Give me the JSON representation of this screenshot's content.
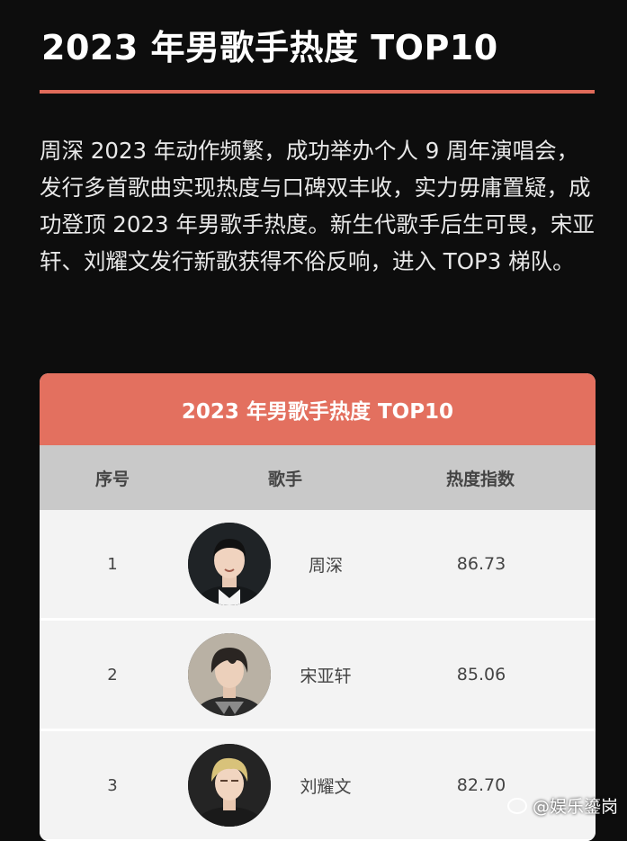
{
  "title": "2023 年男歌手热度 TOP10",
  "paragraph": "周深 2023 年动作频繁，成功举办个人 9 周年演唱会，发行多首歌曲实现热度与口碑双丰收，实力毋庸置疑，成功登顶 2023 年男歌手热度。新生代歌手后生可畏，宋亚轩、刘耀文发行新歌获得不俗反响，进入 TOP3 梯队。",
  "table": {
    "title": "2023 年男歌手热度 TOP10",
    "columns": [
      "序号",
      "歌手",
      "热度指数"
    ],
    "rows": [
      {
        "rank": "1",
        "name": "周深",
        "score": "86.73",
        "avatar_icon": "singer-portrait-icon"
      },
      {
        "rank": "2",
        "name": "宋亚轩",
        "score": "85.06",
        "avatar_icon": "singer-portrait-icon"
      },
      {
        "rank": "3",
        "name": "刘耀文",
        "score": "82.70",
        "avatar_icon": "singer-portrait-icon"
      }
    ]
  },
  "watermark": "@娱乐鎏岗",
  "colors": {
    "background": "#0d0d0d",
    "accent": "#e3705f",
    "header_row": "#c9c9c9"
  }
}
